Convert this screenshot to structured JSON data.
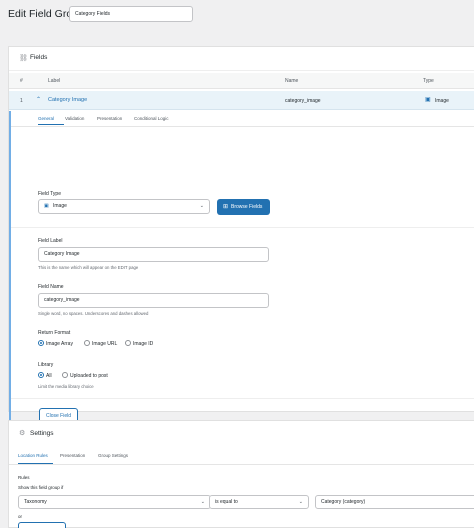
{
  "header": {
    "title": "Edit Field Group",
    "group_name": "Category Fields"
  },
  "fields_panel": {
    "title": "Fields",
    "columns": {
      "num": "#",
      "label": "Label",
      "name": "Name",
      "type": "Type"
    },
    "row": {
      "num": "1",
      "label": "Category Image",
      "name": "category_image",
      "type": "Image"
    }
  },
  "editor": {
    "tabs": [
      "General",
      "Validation",
      "Presentation",
      "Conditional Logic"
    ],
    "active_tab": "General",
    "field_type": {
      "label": "Field Type",
      "value": "Image"
    },
    "browse_label": "Browse Fields",
    "field_label": {
      "label": "Field Label",
      "value": "Category Image",
      "hint": "This is the name which will appear on the EDIT page"
    },
    "field_name": {
      "label": "Field Name",
      "value": "category_image",
      "hint": "Single word, no spaces. Underscores and dashes allowed"
    },
    "return_format": {
      "label": "Return Format",
      "options": [
        "Image Array",
        "Image URL",
        "Image ID"
      ],
      "selected": "Image Array"
    },
    "library": {
      "label": "Library",
      "options": [
        "All",
        "Uploaded to post"
      ],
      "selected": "All",
      "hint": "Limit the media library choice"
    },
    "close_label": "Close Field"
  },
  "settings_panel": {
    "title": "Settings",
    "tabs": [
      "Location Rules",
      "Presentation",
      "Group Settings"
    ],
    "active_tab": "Location Rules",
    "rules_label": "Rules",
    "show_if_label": "Show this field group if",
    "rule": {
      "param": "Taxonomy",
      "operator": "is equal to",
      "value": "Category (category)"
    },
    "or_label": "or"
  },
  "colors": {
    "accent": "#2271b1",
    "row_highlight": "#e9f3f9",
    "editor_border": "#72aee6"
  },
  "icons": {
    "fields": "link-icon",
    "settings": "gear-icon",
    "type": "image-icon",
    "browse": "grid-icon"
  }
}
